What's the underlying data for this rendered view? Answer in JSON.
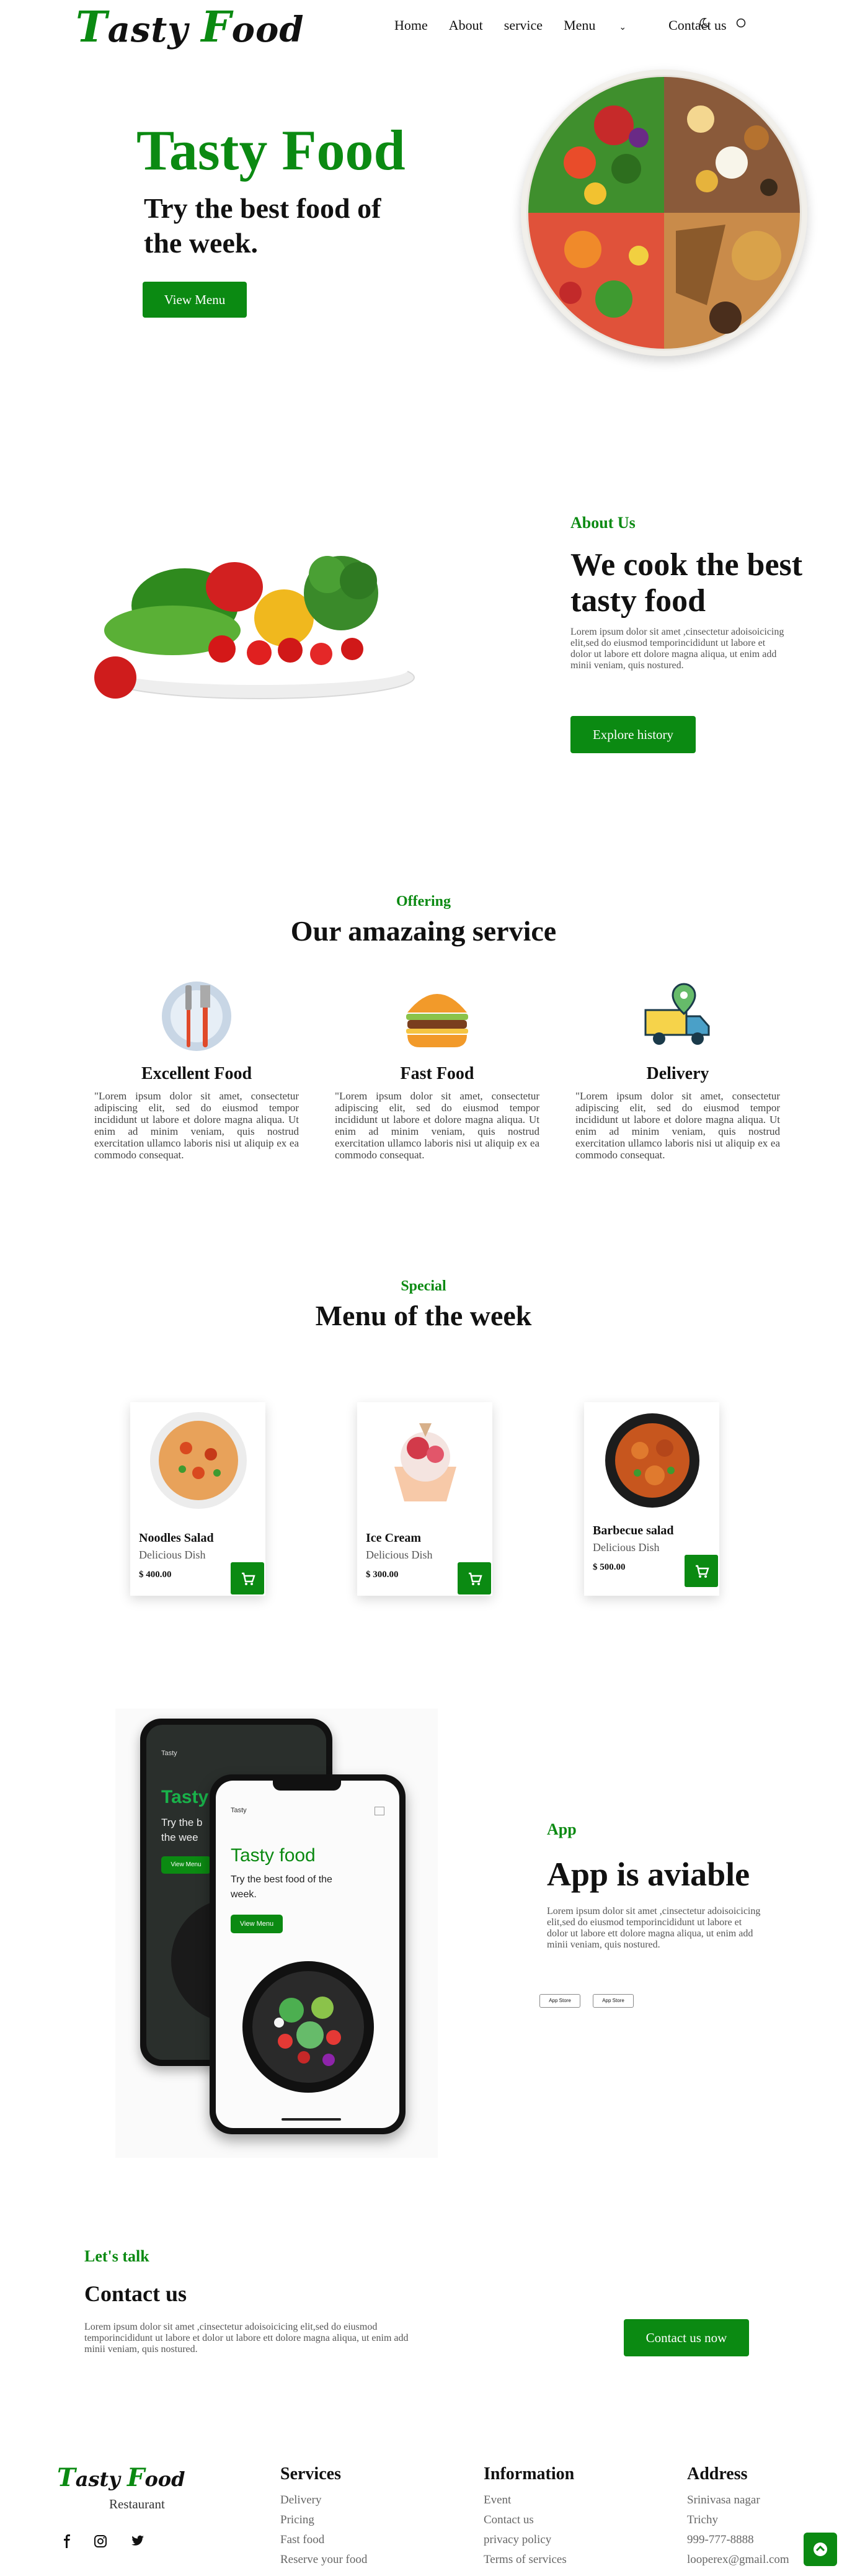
{
  "brand": {
    "logo_cap1": "T",
    "logo_rest1": "asty ",
    "logo_cap2": "F",
    "logo_rest2": "ood",
    "footer_sub": "Restaurant"
  },
  "nav": {
    "items": [
      "Home",
      "About",
      "service",
      "Menu",
      "Contact us"
    ],
    "icons": [
      "moon-icon",
      "circle-icon"
    ]
  },
  "hero": {
    "title": "Tasty Food",
    "subtitle": "Try the best food of the week.",
    "button": "View Menu"
  },
  "about": {
    "kicker": "About Us",
    "title": "We cook the best tasty food",
    "text": "Lorem ipsum dolor sit amet ,cinsectetur adoisoicicing elit,sed do eiusmod temporincididunt ut labore et dolor ut labore ett dolore magna aliqua, ut enim add minii veniam, quis nostured.",
    "button": "Explore history"
  },
  "offering": {
    "kicker": "Offering",
    "title": "Our amazaing service",
    "items": [
      {
        "title": "Excellent Food",
        "icon": "cutlery-icon",
        "text": "\"Lorem ipsum dolor sit amet, consectetur adipiscing elit, sed do eiusmod tempor incididunt ut labore et dolore magna aliqua. Ut enim ad minim veniam, quis nostrud exercitation ullamco laboris nisi ut aliquip ex ea commodo consequat."
      },
      {
        "title": "Fast Food",
        "icon": "burger-icon",
        "text": "\"Lorem ipsum dolor sit amet, consectetur adipiscing elit, sed do eiusmod tempor incididunt ut labore et dolore magna aliqua. Ut enim ad minim veniam, quis nostrud exercitation ullamco laboris nisi ut aliquip ex ea commodo consequat."
      },
      {
        "title": "Delivery",
        "icon": "delivery-truck-icon",
        "text": "\"Lorem ipsum dolor sit amet, consectetur adipiscing elit, sed do eiusmod tempor incididunt ut labore et dolore magna aliqua. Ut enim ad minim veniam, quis nostrud exercitation ullamco laboris nisi ut aliquip ex ea commodo consequat."
      }
    ]
  },
  "menu": {
    "kicker": "Special",
    "title": "Menu of the week",
    "cards": [
      {
        "name": "Noodles Salad",
        "sub": "Delicious Dish",
        "price": "$ 400.00"
      },
      {
        "name": "Ice Cream",
        "sub": "Delicious Dish",
        "price": "$ 300.00"
      },
      {
        "name": "Barbecue salad",
        "sub": "Delicious Dish",
        "price": "$ 500.00"
      }
    ]
  },
  "app": {
    "kicker": "App",
    "title": "App is aviable",
    "text": "Lorem ipsum dolor sit amet ,cinsectetur adoisoicicing elit,sed do eiusmod temporincididunt ut labore et dolor ut labore ett dolore magna aliqua, ut enim add minii veniam, quis nostured.",
    "stores": [
      "App Store",
      "App Store"
    ],
    "phone": {
      "brand": "Tasty",
      "title": "Tasty food",
      "sub": "Try the best food of the week.",
      "button": "View Menu",
      "back_title": "Tasty",
      "back_sub": "Try the b the wee"
    }
  },
  "talk": {
    "kicker": "Let's talk",
    "title": "Contact us",
    "text": "Lorem ipsum dolor sit amet ,cinsectetur adoisoicicing elit,sed do eiusmod temporincididunt ut labore et dolor ut labore ett dolore magna aliqua, ut enim add minii veniam, quis nostured.",
    "button": "Contact us now"
  },
  "footer": {
    "services": {
      "title": "Services",
      "links": [
        "Delivery",
        "Pricing",
        "Fast food",
        "Reserve your food"
      ]
    },
    "information": {
      "title": "Information",
      "links": [
        "Event",
        "Contact us",
        "privacy policy",
        "Terms of services"
      ]
    },
    "address": {
      "title": "Address",
      "links": [
        "Srinivasa nagar",
        "Trichy",
        "999-777-8888",
        "looperex@gmail.com"
      ]
    },
    "social": [
      "facebook-icon",
      "instagram-icon",
      "twitter-icon"
    ]
  },
  "colors": {
    "accent": "#0b8a12"
  }
}
